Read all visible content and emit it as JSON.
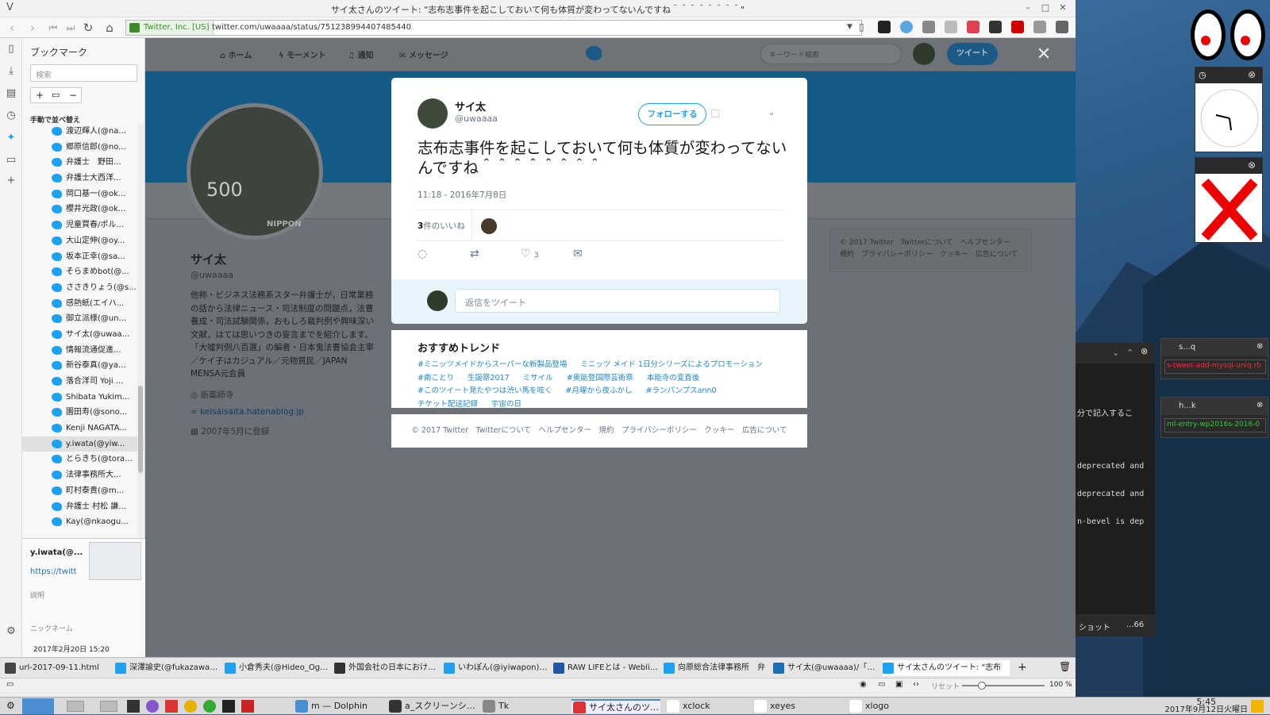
{
  "browser": {
    "window_title": "サイ太さんのツイート: \"志布志事件を起こしておいて何も体質が変わってないんですね＾＾＾＾＾＾＾＾\"",
    "security_label": "Twitter, Inc. [US]",
    "url": "twitter.com/uwaaaa/status/751238994407485440",
    "zoom": "100 %",
    "reset_label": "リセット"
  },
  "bookmarks": {
    "title": "ブックマーク",
    "search_placeholder": "検索",
    "sort_label": "手動で並べ替え",
    "items": [
      "渡辺輝人(@na...",
      "郷原信郎(@no...",
      "弁護士　野田...",
      "弁護士大西洋...",
      "岡口基一(@ok...",
      "櫻井光政(@ok...",
      "児童買春/ポル...",
      "大山定伸(@oy...",
      "坂本正幸(@sa...",
      "そらまめbot(@...",
      "ささきりょう(@s...",
      "感熱紙(エイハ...",
      "御立派様(@un...",
      "サイ太(@uwaa...",
      "情報流通促進...",
      "新谷泰真(@ya...",
      "落合洋司 Yoji ...",
      "Shibata Yukim...",
      "園田寿(@sono...",
      "Kenji NAGATA...",
      "y.iwata(@yiw...",
      "とらきち(@tora...",
      "法律事務所大...",
      "町村泰貴(@m...",
      "弁護士 村松 謙...",
      "Kay(@nkaogu..."
    ],
    "selected_index": 20,
    "detail_name": "y.iwata(@...",
    "detail_url": "https://twitt",
    "description_label": "説明",
    "nickname_label": "ニックネーム",
    "added_date": "2017年2月20日 15:20"
  },
  "twitter_nav": {
    "home": "ホーム",
    "moments": "モーメント",
    "notifications": "通知",
    "messages": "メッセージ",
    "search_placeholder": "キーワード検索",
    "tweet_button": "ツイート"
  },
  "profile": {
    "name": "サイ太",
    "handle": "@uwaaaa",
    "bio": "他称・ビジネス法務系スター弁護士が，日常業務の話から法律ニュース・司法制度の問題点，法曹養成・司法試験関係，おもしろ裁判例や興味深い文献，はては思いつきの妄言までを紹介します。「大噓判例八百選」の編者・日本鬼法曹協会主宰／ケイ子はカジュアル／元物買民／JAPAN MENSA元会員",
    "location": "新薬師寺",
    "website": "keisaisaita.hatenablog.jp",
    "joined": "2007年5月に登録",
    "stamp_text": "500",
    "stamp_country": "NIPPON"
  },
  "side_footer": {
    "line1": "© 2017 Twitter　Twitterについて　ヘルプセンター",
    "line2": "規約　プライバシーポリシー　クッキー　広告について"
  },
  "tweet": {
    "author_name": "サイ太",
    "author_handle": "@uwaaaa",
    "follow_label": "フォローする",
    "text": "志布志事件を起こしておいて何も体質が変わってないんですね＾＾＾＾＾＾＾＾",
    "timestamp": "11:18 - 2016年7月8日",
    "likes_count": "3",
    "likes_label": "件のいいね",
    "like_action_count": "3",
    "reply_placeholder": "返信をツイート"
  },
  "trends": {
    "title": "おすすめトレンド",
    "items": [
      "#ミニッツメイドからスーパーな新製品登場",
      "ミニッツ メイド 1日分シリーズによるプロモーション",
      "#南ことり",
      "生誕祭2017",
      "ミサイル",
      "#奥能登国際芸術祭",
      "本能寺の変直後",
      "#このツイート見たやつは渋い馬を呟く",
      "#月曜から夜ふかし",
      "#ランパンプスann0",
      "チケット配送記録",
      "宇宙の日"
    ]
  },
  "modal_footer": "© 2017 Twitter　Twitterについて　ヘルプセンター　規約　プライバシーポリシー　クッキー　広告について",
  "tabs": [
    "url-2017-09-11.html",
    "深澤諭史(@fukazawas)さ",
    "小倉秀夫(@Hideo_Ogura",
    "外国会社の日本における代",
    "いわぽん(@iyiwapon)さん",
    "RAW LIFEとは - Weblio辞",
    "向原総合法律事務所　弁",
    "サイ太(@uwaaaa)/「志布",
    "サイ太さんのツイート: \"志布"
  ],
  "terminal": {
    "lines": [
      "分で記入するこ",
      "deprecated and",
      "deprecated and",
      "n-bevel is dep"
    ],
    "footer_left": "ショット",
    "footer_right": "...66"
  },
  "notes": [
    {
      "title": "s...q",
      "text": "s-tweet-add-mysql-uniq.rb"
    },
    {
      "title": "h...k",
      "text": "ml-entry-wp2016s-2016-0"
    }
  ],
  "taskbar": {
    "items": [
      "m — Dolphin",
      "a_スクリーンショ...",
      "Tk",
      "サイ太さんのツイ...",
      "xclock",
      "xeyes",
      "xlogo"
    ],
    "time": "5:45",
    "date": "2017年9月12日火曜日"
  },
  "colors": {
    "twitter_blue": "#1da1f2",
    "banner": "#135a86",
    "overlay": "#6c7077"
  }
}
